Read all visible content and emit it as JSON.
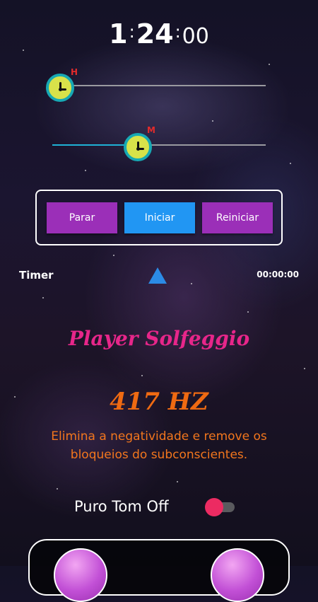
{
  "clock": {
    "hours": "1",
    "sep1": ":",
    "minutes": "24",
    "sep2": ":",
    "seconds": "00"
  },
  "sliders": {
    "hours": {
      "tag": "H",
      "value_fraction": 0.0
    },
    "minutes": {
      "tag": "M",
      "value_fraction": 0.4
    }
  },
  "controls": {
    "stop_label": "Parar",
    "start_label": "Iniciar",
    "restart_label": "Reiniciar"
  },
  "timer": {
    "label": "Timer",
    "value": "00:00:00"
  },
  "player": {
    "title": "Player Solfeggio",
    "frequency": "417 HZ",
    "description": "Elimina a negatividade e remove os bloqueios do subconscientes."
  },
  "pure_tone": {
    "label": "Puro Tom Off",
    "enabled": false
  },
  "colors": {
    "accent_purple": "#9b2fb8",
    "accent_blue": "#2196f3",
    "title_pink": "#e7268a",
    "hz_orange": "#ef6a12",
    "toggle_pink": "#ec2b62"
  },
  "icons": {
    "slider_knob": "clock-icon",
    "timer_indicator": "triangle-up-icon"
  }
}
